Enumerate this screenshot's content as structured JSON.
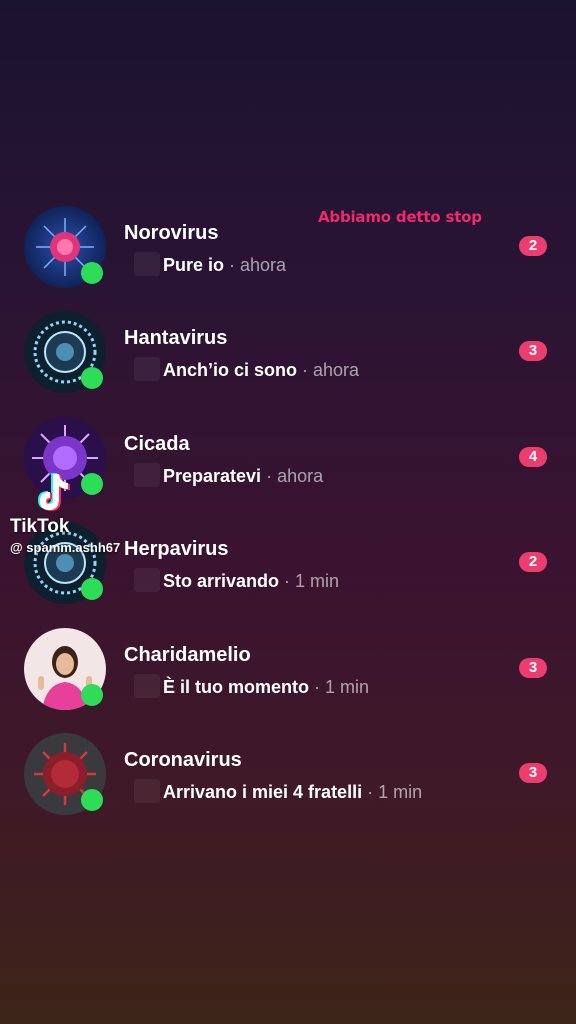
{
  "overlay_caption": "Abbiamo detto stop",
  "watermark": {
    "brand": "TikTok",
    "handle": "@ spamm.ashh67"
  },
  "chats": [
    {
      "name": "Norovirus",
      "message": "Pure io",
      "separator": " · ",
      "time": "ahora",
      "unread": "2",
      "avatar_icon": "virus-pink-icon"
    },
    {
      "name": "Hantavirus",
      "message": "Anch’io ci sono",
      "separator": " · ",
      "time": "ahora",
      "unread": "3",
      "avatar_icon": "virus-blue-icon"
    },
    {
      "name": "Cicada",
      "message": "Preparatevi",
      "separator": " · ",
      "time": "ahora",
      "unread": "4",
      "avatar_icon": "virus-purple-icon"
    },
    {
      "name": "Herpavirus",
      "message": "Sto arrivando",
      "separator": " · ",
      "time": "1 min",
      "unread": "2",
      "avatar_icon": "virus-blue-icon"
    },
    {
      "name": "Charidamelio",
      "message": "È il tuo momento",
      "separator": " · ",
      "time": "1 min",
      "unread": "3",
      "avatar_icon": "person-photo"
    },
    {
      "name": "Coronavirus",
      "message": "Arrivano i miei 4 fratelli",
      "separator": " · ",
      "time": "1 min",
      "unread": "3",
      "avatar_icon": "virus-red-icon"
    }
  ],
  "colors": {
    "accent_pink": "#ec3d6f",
    "caption_pink": "#f0286c",
    "online_green": "#2ddc57"
  }
}
